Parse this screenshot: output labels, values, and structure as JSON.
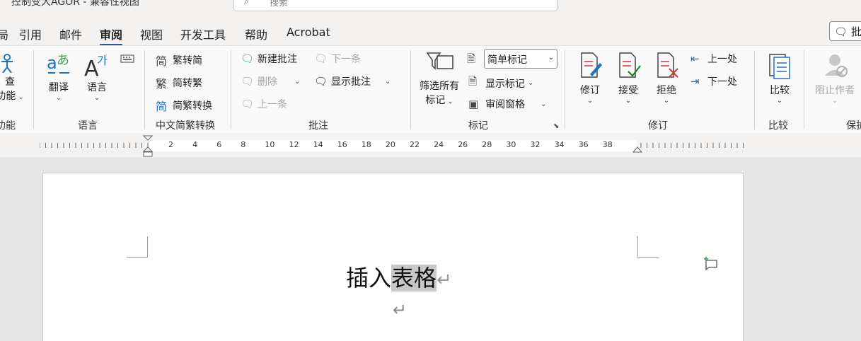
{
  "titlebar": {
    "title": "控制变大AGOR - 兼容性视图",
    "search_placeholder": "搜索"
  },
  "tabs": [
    {
      "label": "局"
    },
    {
      "label": "引用"
    },
    {
      "label": "邮件"
    },
    {
      "label": "审阅"
    },
    {
      "label": "视图"
    },
    {
      "label": "开发工具"
    },
    {
      "label": "帮助"
    },
    {
      "label": "Acrobat"
    }
  ],
  "comments_button": "批注",
  "ribbon": {
    "accessibility": {
      "line1": "查",
      "line2": "功能"
    },
    "translate": "翻译",
    "language": "语言",
    "group_language": "语言",
    "trad_to_simp": "繁转简",
    "simp_to_trad": "简转繁",
    "convert": "简繁转换",
    "group_chinese": "中文简繁转换",
    "new_comment": "新建批注",
    "delete": "删除",
    "prev_comment": "上一条",
    "next_comment": "下一条",
    "show_comments": "显示批注",
    "group_comments": "批注",
    "filter_markup_line1": "筛选所有",
    "filter_markup_line2": "标记",
    "markup_mode": "简单标记",
    "show_markup": "显示标记",
    "review_pane": "审阅窗格",
    "group_markup": "标记",
    "track_changes": "修订",
    "accept": "接受",
    "reject": "拒绝",
    "previous_change": "上一处",
    "next_change": "下一处",
    "group_tracking": "修订",
    "compare": "比较",
    "group_compare": "比较",
    "block_authors": "阻止作者",
    "group_protect": "保护"
  },
  "ruler_numbers": [
    "2",
    "4",
    "6",
    "8",
    "10",
    "12",
    "14",
    "16",
    "18",
    "20",
    "22",
    "24",
    "26",
    "28",
    "30",
    "32",
    "34",
    "36",
    "38"
  ],
  "document": {
    "plain": "插入",
    "selected": "表格",
    "para_mark": "↵"
  },
  "colors": {
    "accent": "#2b579a",
    "translate_blue": "#1e73be",
    "translate_green": "#35a853",
    "reject_red": "#d13438",
    "accept_green": "#107c10"
  }
}
